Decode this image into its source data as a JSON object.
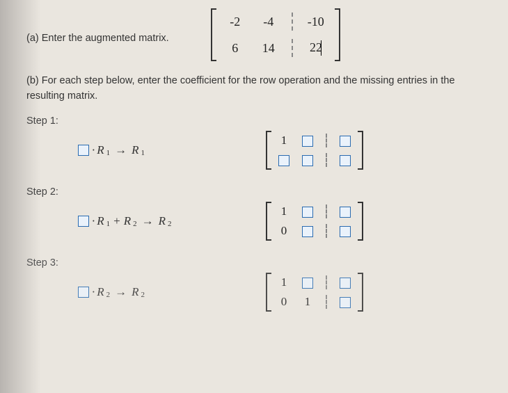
{
  "part_a": {
    "prompt": "(a) Enter the augmented matrix.",
    "matrix": {
      "left": [
        [
          "-2",
          "-4"
        ],
        [
          "6",
          "14"
        ]
      ],
      "right": [
        "-10",
        "22"
      ]
    }
  },
  "part_b": {
    "prompt": "(b) For each step below, enter the coefficient for the row operation and the missing entries in the resulting matrix."
  },
  "steps": [
    {
      "label": "Step 1:",
      "op": {
        "type": "scale",
        "src": "R",
        "src_sub": "1",
        "dest": "R",
        "dest_sub": "1"
      },
      "matrix_fixed": {
        "r1c1": "1"
      }
    },
    {
      "label": "Step 2:",
      "op": {
        "type": "add",
        "src": "R",
        "src_sub": "1",
        "plus": "R",
        "plus_sub": "2",
        "dest": "R",
        "dest_sub": "2"
      },
      "matrix_fixed": {
        "r1c1": "1",
        "r2c1": "0"
      }
    },
    {
      "label": "Step 3:",
      "op": {
        "type": "scale",
        "src": "R",
        "src_sub": "2",
        "dest": "R",
        "dest_sub": "2"
      },
      "matrix_fixed": {
        "r1c1": "1",
        "r2c1": "0",
        "r2c2": "1"
      }
    }
  ]
}
